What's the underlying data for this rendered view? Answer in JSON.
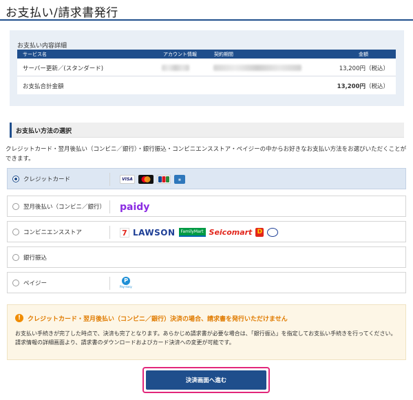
{
  "page": {
    "title": "お支払い/請求書発行"
  },
  "summary": {
    "heading": "お支払い内容詳細",
    "columns": [
      "サービス名",
      "アカウント情報",
      "契約期間",
      "金額"
    ],
    "rows": [
      {
        "service": "サーバー更新／(スタンダード)",
        "amount": "13,200円（税込）"
      }
    ],
    "total": {
      "label": "お支払合計金額",
      "amount": "13,200円",
      "tax": "（税込）"
    }
  },
  "payment": {
    "heading": "お支払い方法の選択",
    "description": "クレジットカード・翌月後払い（コンビニ／銀行）・銀行振込・コンビニエンスストア・ペイジーの中からお好きなお支払い方法をお選びいただくことができます。",
    "options": [
      {
        "label": "クレジットカード",
        "selected": true
      },
      {
        "label": "翌月後払い（コンビニ／銀行）",
        "selected": false
      },
      {
        "label": "コンビニエンスストア",
        "selected": false
      },
      {
        "label": "銀行振込",
        "selected": false
      },
      {
        "label": "ペイジー",
        "selected": false
      }
    ],
    "card_brands": [
      "VISA",
      "Mastercard",
      "JCB",
      "AMEX"
    ],
    "paidy_logo": "paidy",
    "stores": [
      "LAWSON",
      "FamilyMart",
      "Seicomart"
    ],
    "payeasy_logo": "Pay-easy"
  },
  "notice": {
    "title": "クレジットカード・翌月後払い（コンビニ／銀行）決済の場合、請求書を発行いただけません",
    "body": "お支払い手続きが完了した時点で、決済も完了となります。あらかじめ請求書が必要な場合は、「銀行振込」を指定してお支払い手続きを行ってください。請求情報の詳細画面より、請求書のダウンロードおよびカード決済への変更が可能です。"
  },
  "button": {
    "label": "決済画面へ進む"
  },
  "colors": {
    "brand": "#1f4e8c",
    "warning": "#e07b00",
    "highlight": "#e2267a"
  }
}
